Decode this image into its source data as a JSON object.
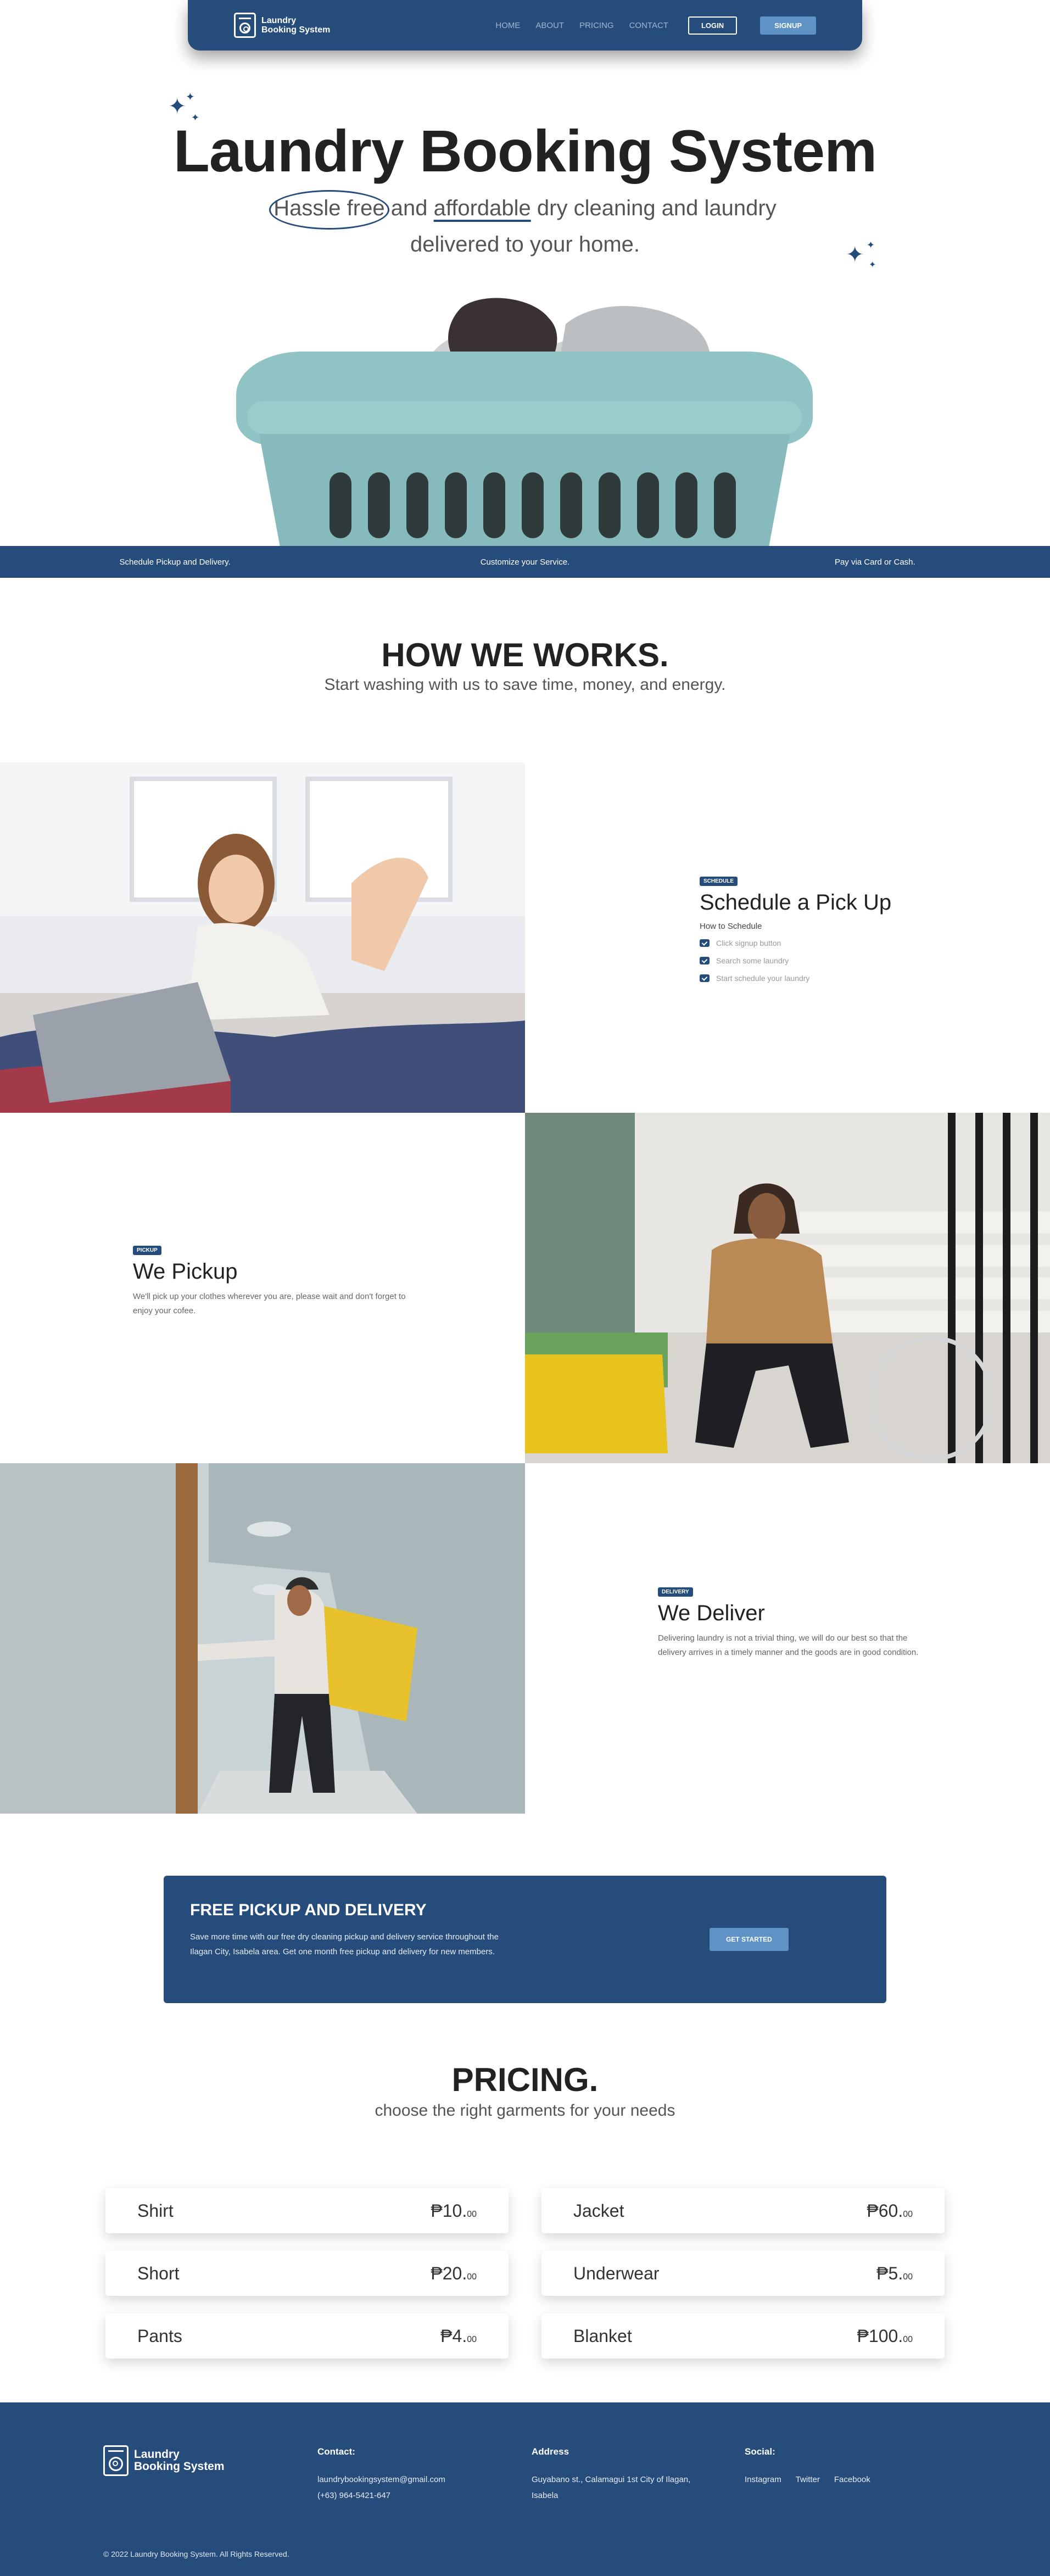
{
  "nav": {
    "brand_line1": "Laundry",
    "brand_line2": "Booking System",
    "links": [
      "HOME",
      "ABOUT",
      "PRICING",
      "CONTACT"
    ],
    "login_label": "LOGIN",
    "signup_label": "SIGNUP"
  },
  "hero": {
    "title": "Laundry Booking System",
    "sub_part1": "Hassle free",
    "sub_part2": "and",
    "sub_part3": "affordable",
    "sub_part4": "dry cleaning and laundry",
    "sub_line2": "delivered to your home."
  },
  "features": [
    "Schedule Pickup and Delivery.",
    "Customize your Service.",
    "Pay via Card or Cash."
  ],
  "how": {
    "title": "HOW WE WORKS.",
    "subtitle": "Start washing with us to save time, money, and energy.",
    "schedule": {
      "tag": "SCHEDULE",
      "title": "Schedule a Pick Up",
      "howto": "How to Schedule",
      "steps": [
        "Click signup button",
        "Search some laundry",
        "Start schedule your laundry"
      ]
    },
    "pickup": {
      "tag": "PICKUP",
      "title": "We Pickup",
      "text": "We'll pick up your clothes wherever you are, please wait and don't forget to enjoy your cofee."
    },
    "delivery": {
      "tag": "DELIVERY",
      "title": "We Deliver",
      "text": "Delivering laundry is not a trivial thing, we will do our best so that the delivery arrives in a timely manner and the goods are in good condition."
    }
  },
  "cta": {
    "title": "FREE PICKUP AND DELIVERY",
    "text": "Save more time with our free dry cleaning pickup and delivery service throughout the Ilagan City, Isabela area. Get one month free pickup and delivery for new members.",
    "button": "GET STARTED"
  },
  "pricing": {
    "title": "PRICING.",
    "subtitle": "choose the right garments for your needs",
    "items": [
      {
        "name": "Shirt",
        "price": "₱10.",
        "cents": "00"
      },
      {
        "name": "Jacket",
        "price": "₱60.",
        "cents": "00"
      },
      {
        "name": "Short",
        "price": "₱20.",
        "cents": "00"
      },
      {
        "name": "Underwear",
        "price": "₱5.",
        "cents": "00"
      },
      {
        "name": "Pants",
        "price": "₱4.",
        "cents": "00"
      },
      {
        "name": "Blanket",
        "price": "₱100.",
        "cents": "00"
      }
    ]
  },
  "footer": {
    "contact_title": "Contact:",
    "email": "laundrybookingsystem@gmail.com",
    "phone": "(+63) 964-5421-647",
    "address_title": "Address",
    "address_line1": "Guyabano st., Calamagui 1st City of Ilagan,",
    "address_line2": "Isabela",
    "social_title": "Social:",
    "social": [
      "Instagram",
      "Twitter",
      "Facebook"
    ],
    "copyright": "© 2022 Laundry Booking System. All Rights Reserved."
  },
  "colors": {
    "primary": "#264c7c",
    "accent": "#5f93c5",
    "text": "#2b2b2b"
  }
}
